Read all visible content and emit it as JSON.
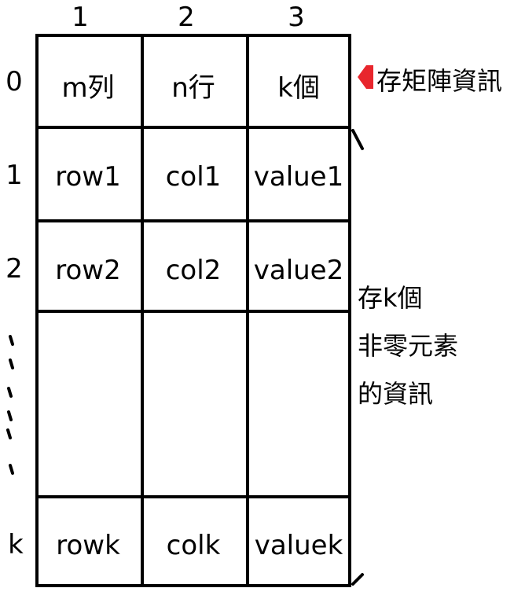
{
  "column_headers": [
    "1",
    "2",
    "3"
  ],
  "row_headers": {
    "r0": "0",
    "r1": "1",
    "r2": "2",
    "rk": "k"
  },
  "cells": {
    "r0": [
      "m列",
      "n行",
      "k個"
    ],
    "r1": [
      "row1",
      "col1",
      "value1"
    ],
    "r2": [
      "row2",
      "col2",
      "value2"
    ],
    "rk": [
      "rowk",
      "colk",
      "valuek"
    ]
  },
  "annotations": {
    "matrix_info": "存矩陣資訊",
    "nonzero_line1": "存k個",
    "nonzero_line2": "非零元素",
    "nonzero_line3": "的資訊"
  },
  "colors": {
    "arrow": "#e8262d",
    "lines": "#000000"
  }
}
